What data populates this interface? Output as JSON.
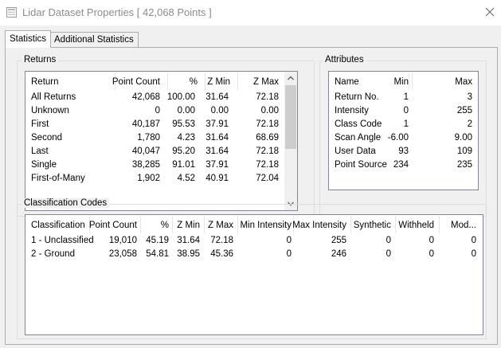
{
  "window": {
    "title": "Lidar Dataset Properties [ 42,068 Points ]"
  },
  "tabs": [
    {
      "label": "Statistics"
    },
    {
      "label": "Additional Statistics"
    }
  ],
  "returns": {
    "group_title": "Returns",
    "columns": [
      "Return",
      "Point Count",
      "%",
      "Z Min",
      "Z Max"
    ],
    "rows": [
      [
        "All Returns",
        "42,068",
        "100.00",
        "31.64",
        "72.18"
      ],
      [
        "Unknown",
        "0",
        "0.00",
        "0.00",
        "0.00"
      ],
      [
        "First",
        "40,187",
        "95.53",
        "37.91",
        "72.18"
      ],
      [
        "Second",
        "1,780",
        "4.23",
        "31.64",
        "68.69"
      ],
      [
        "Last",
        "40,047",
        "95.20",
        "31.64",
        "72.18"
      ],
      [
        "Single",
        "38,285",
        "91.01",
        "37.91",
        "72.18"
      ],
      [
        "First-of-Many",
        "1,902",
        "4.52",
        "40.91",
        "72.04"
      ]
    ]
  },
  "attributes": {
    "group_title": "Attributes",
    "columns": [
      "Name",
      "Min",
      "Max"
    ],
    "rows": [
      [
        "Return No.",
        "1",
        "3"
      ],
      [
        "Intensity",
        "0",
        "255"
      ],
      [
        "Class Code",
        "1",
        "2"
      ],
      [
        "Scan Angle",
        "-6.00",
        "9.00"
      ],
      [
        "User Data",
        "93",
        "109"
      ],
      [
        "Point Source",
        "234",
        "235"
      ]
    ]
  },
  "classification": {
    "group_title": "Classification Codes",
    "columns": [
      "Classification",
      "Point Count",
      "%",
      "Z Min",
      "Z Max",
      "Min Intensity",
      "Max Intensity",
      "Synthetic",
      "Withheld",
      "Mod..."
    ],
    "rows": [
      [
        "1 - Unclassified",
        "19,010",
        "45.19",
        "31.64",
        "72.18",
        "0",
        "255",
        "0",
        "0",
        "0"
      ],
      [
        "2 - Ground",
        "23,058",
        "54.81",
        "38.95",
        "45.36",
        "0",
        "246",
        "0",
        "0",
        "0"
      ]
    ]
  },
  "icons": {
    "app": "lidar-dataset-icon",
    "close": "close-icon",
    "scroll_up": "scroll-up-arrow-icon",
    "scroll_down": "scroll-down-arrow-icon"
  }
}
